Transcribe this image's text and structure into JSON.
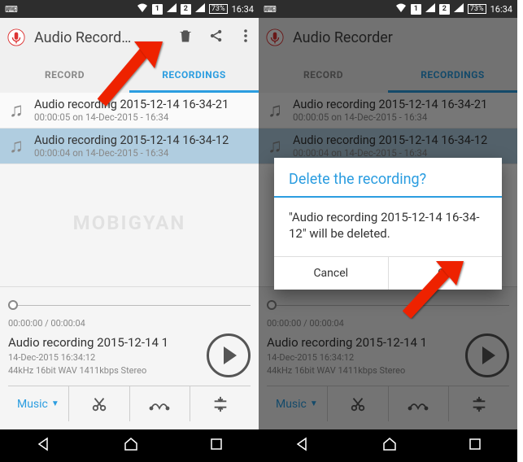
{
  "status": {
    "battery": "73%",
    "time": "16:34",
    "sim1": "1",
    "sim2": "2"
  },
  "left": {
    "app_title": "Audio Record…",
    "tabs": {
      "record": "RECORD",
      "recordings": "RECORDINGS"
    },
    "items": [
      {
        "title": "Audio recording 2015-12-14 16-34-21",
        "sub": "00:00:05 on 14-Dec-2015 - 16:34"
      },
      {
        "title": "Audio recording 2015-12-14 16-34-12",
        "sub": "00:00:04 on 14-Dec-2015 - 16:34"
      }
    ],
    "player": {
      "time": "00:00:00 / 00:00:04",
      "title": "Audio recording 2015-12-14 1",
      "sub1": "14-Dec-2015 16:34:12",
      "sub2": "44kHz 16bit WAV 1411kbps Stereo",
      "music": "Music"
    }
  },
  "right": {
    "app_title": "Audio Recorder",
    "tabs": {
      "record": "RECORD",
      "recordings": "RECORDINGS"
    },
    "items": [
      {
        "title": "Audio recording 2015-12-14 16-34-21",
        "sub": "00:00:05 on 14-Dec-2015 - 16:34"
      },
      {
        "title": "Audio recording 2015-12-14 16-34-12",
        "sub": "00:00:04 on 14-Dec-2015 - 16:34"
      }
    ],
    "player": {
      "time": "00:00:00 / 00:00:04",
      "title": "Audio recording 2015-12-14 1",
      "sub1": "14-Dec-2015 16:34:12",
      "sub2": "44kHz 16bit WAV 1411kbps Stereo",
      "music": "Music"
    },
    "dialog": {
      "title": "Delete the recording?",
      "body": "\"Audio recording 2015-12-14 16-34-12\" will be deleted.",
      "cancel": "Cancel",
      "ok": "OK"
    }
  },
  "watermark": "MOBIGYAN"
}
